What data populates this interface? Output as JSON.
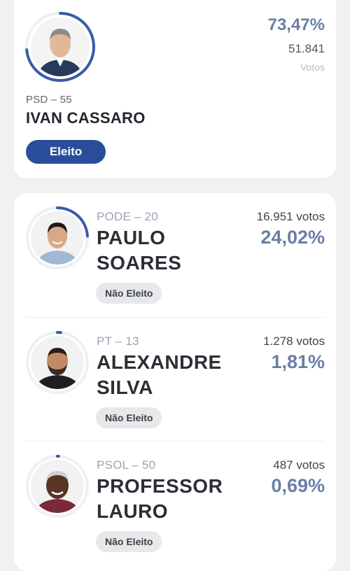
{
  "winner": {
    "party": "PSD – 55",
    "name": "IVAN CASSARO",
    "status": "Eleito",
    "percent": "73,47%",
    "votes": "51.841",
    "votes_label": "Votos",
    "progress": 0.7347,
    "avatar": "candidate-photo"
  },
  "candidates": [
    {
      "party": "PODE – 20",
      "name": "PAULO SOARES",
      "votes": "16.951 votos",
      "percent": "24,02%",
      "status": "Não Eleito",
      "progress": 0.2402
    },
    {
      "party": "PT – 13",
      "name": "ALEXANDRE SILVA",
      "votes": "1.278 votos",
      "percent": "1,81%",
      "status": "Não Eleito",
      "progress": 0.0181
    },
    {
      "party": "PSOL – 50",
      "name": "PROFESSOR LAURO",
      "votes": "487 votos",
      "percent": "0,69%",
      "status": "Não Eleito",
      "progress": 0.0069
    }
  ],
  "colors": {
    "accent": "#6a7ea5",
    "ring": "#3a5aa8",
    "elected_badge": "#2a4d9b",
    "not_elected_badge": "#e7e8ea"
  }
}
